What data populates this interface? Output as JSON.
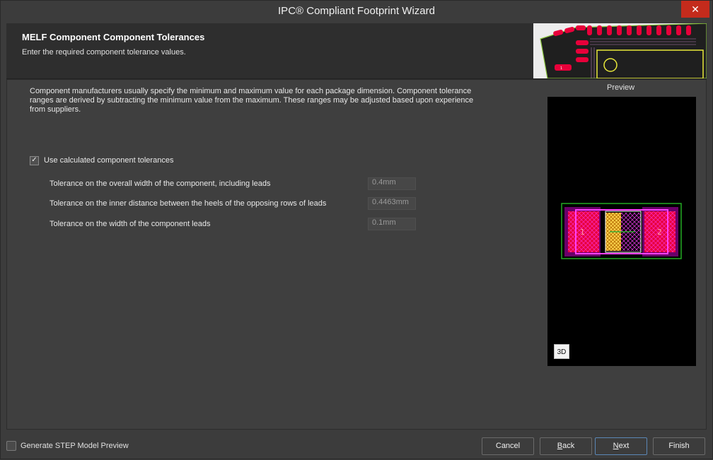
{
  "window": {
    "title": "IPC® Compliant Footprint Wizard",
    "close_glyph": "✕"
  },
  "header": {
    "title": "MELF Component Component Tolerances",
    "subtitle": "Enter the required component tolerance values."
  },
  "body": {
    "description": "Component manufacturers usually specify the minimum and maximum value for each package dimension. Component tolerance ranges are derived by subtracting the minimum value from the maximum. These ranges may be adjusted based upon experience from suppliers.",
    "use_calculated": {
      "label": "Use calculated component tolerances",
      "checked": true,
      "check_glyph": "✓"
    },
    "fields": [
      {
        "label": "Tolerance on the overall width of the component, including leads",
        "value": "0.4mm"
      },
      {
        "label": "Tolerance on the inner distance between the heels of the opposing rows of leads",
        "value": "0.4463mm"
      },
      {
        "label": "Tolerance on the width of the component leads",
        "value": "0.1mm"
      }
    ]
  },
  "preview": {
    "label": "Preview",
    "pad1_label": "1",
    "pad2_label": "2",
    "button_3d": "3D",
    "colors": {
      "pad": "#e8003a",
      "outline": "#22aa22",
      "body": "#ffd34d",
      "silk": "#ff40ff"
    }
  },
  "header_art_pins": [
    "1"
  ],
  "footer": {
    "generate_step": {
      "label": "Generate STEP Model Preview",
      "checked": false
    },
    "buttons": {
      "cancel": "Cancel",
      "back_mnemonic": "B",
      "back_rest": "ack",
      "next_mnemonic": "N",
      "next_rest": "ext",
      "finish": "Finish"
    }
  }
}
